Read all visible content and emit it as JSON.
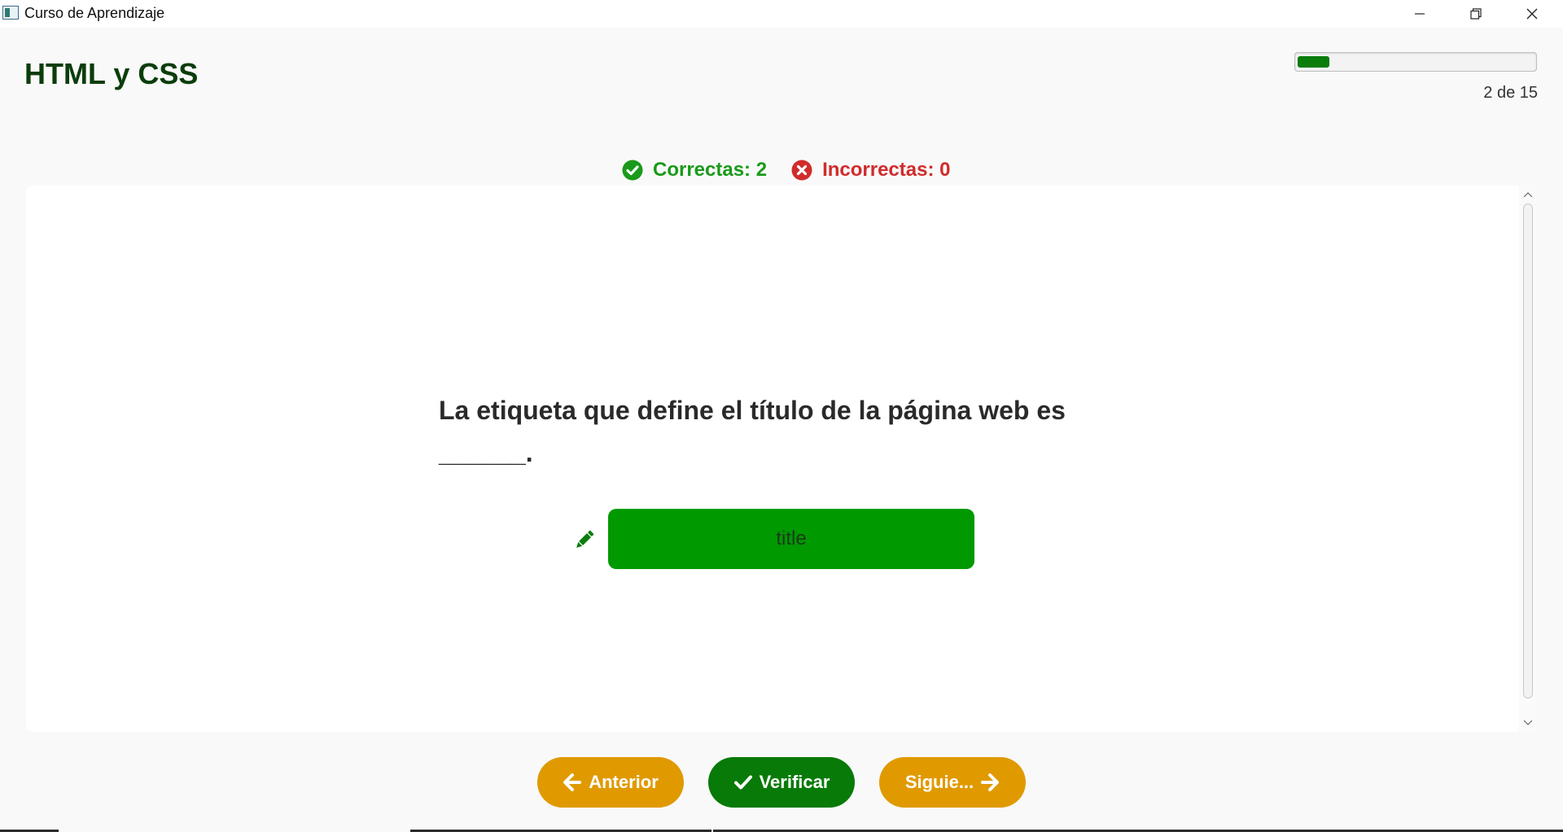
{
  "window": {
    "title": "Curso de Aprendizaje",
    "controls": [
      "minimize-icon",
      "restore-icon",
      "close-icon"
    ]
  },
  "header": {
    "course_title": "HTML y CSS",
    "progress": {
      "current": 2,
      "total": 15,
      "label": "2 de 15"
    }
  },
  "score": {
    "correct_label": "Correctas: 2",
    "incorrect_label": "Incorrectas: 0",
    "correct_icon": "check-circle-icon",
    "incorrect_icon": "x-circle-icon"
  },
  "question": {
    "text": "La etiqueta que define el título de la página web es ______.",
    "edit_icon": "pencil-icon",
    "answer_value": "title"
  },
  "navigation": {
    "prev_label": "Anterior",
    "verify_label": "Verificar",
    "next_label": "Siguie..."
  },
  "colors": {
    "title": "#0b3d0b",
    "progress_fill": "#0a7d0a",
    "correct": "#1a9a1a",
    "incorrect": "#d12b2b",
    "answer_bg": "#009900",
    "nav_orange": "#e09a00",
    "verify_green": "#087a08"
  }
}
